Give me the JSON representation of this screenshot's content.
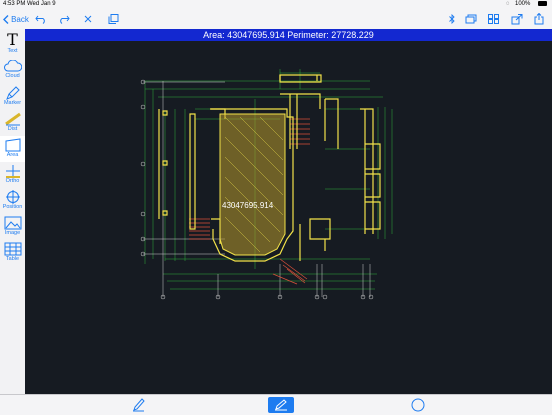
{
  "status_bar": {
    "time": "4:53 PM",
    "date": "Wed Jan 9",
    "battery": "100%"
  },
  "toolbar": {
    "back_label": "Back"
  },
  "sidebar": {
    "tools": [
      {
        "label": "Text",
        "icon": "text-icon"
      },
      {
        "label": "Cloud",
        "icon": "cloud-icon"
      },
      {
        "label": "Marker",
        "icon": "marker-icon"
      },
      {
        "label": "Dist",
        "icon": "distance-icon"
      },
      {
        "label": "Area",
        "icon": "area-icon",
        "active": true
      },
      {
        "label": "Ortho",
        "icon": "ortho-icon"
      },
      {
        "label": "Position",
        "icon": "position-icon"
      },
      {
        "label": "Image",
        "icon": "image-icon"
      },
      {
        "label": "Table",
        "icon": "table-icon"
      }
    ]
  },
  "measurement": {
    "banner": "Area: 43047695.914 Perimeter: 27728.229",
    "shape_label": "43047695.914"
  },
  "colors": {
    "accent": "#1e7cf0",
    "banner": "#1328d0",
    "canvas": "#161b22",
    "wall": "#f2e24a",
    "dim_green": "#2fae3a",
    "area_fill": "#b8992c"
  }
}
